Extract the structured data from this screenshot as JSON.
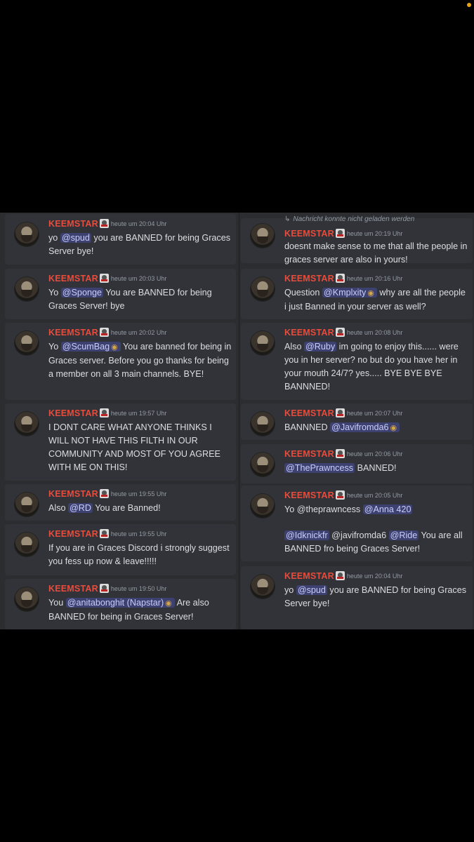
{
  "author": "KEEMSTAR",
  "reply_hint": "Nachricht konnte nicht geladen werden",
  "left": [
    {
      "time": "heute um 20:04 Uhr",
      "parts": [
        {
          "t": "yo "
        },
        {
          "m": "@spud"
        },
        {
          "t": " you are BANNED for being Graces Server bye!"
        }
      ]
    },
    {
      "time": "heute um 20:03 Uhr",
      "parts": [
        {
          "t": "Yo "
        },
        {
          "m": "@Sponge"
        },
        {
          "t": " You are BANNED for being Graces Server! bye"
        }
      ]
    },
    {
      "time": "heute um 20:02 Uhr",
      "parts": [
        {
          "t": "Yo "
        },
        {
          "m": "@ScumBag",
          "badge": true
        },
        {
          "t": " You are banned for being in Graces server. Before you go thanks for being a member on all 3 main channels. BYE!"
        }
      ]
    },
    {
      "time": "heute um 19:57 Uhr",
      "parts": [
        {
          "t": "I DONT CARE WHAT ANYONE THINKS I WILL NOT HAVE THIS FILTH IN OUR COMMUNITY AND MOST OF YOU AGREE WITH ME ON THIS!"
        }
      ]
    },
    {
      "time": "heute um 19:55 Uhr",
      "parts": [
        {
          "t": "Also "
        },
        {
          "m": "@RD"
        },
        {
          "t": " You are Banned!"
        }
      ]
    },
    {
      "time": "heute um 19:55 Uhr",
      "parts": [
        {
          "t": "If you are in Graces Discord i strongly suggest you fess up now & leave!!!!!"
        }
      ]
    },
    {
      "time": "heute um 19:50 Uhr",
      "parts": [
        {
          "t": "You "
        },
        {
          "m": "@anitabonghit (Napstar)",
          "badge": true
        },
        {
          "t": "  Are also BANNED for being in Graces Server!"
        }
      ]
    }
  ],
  "right": [
    {
      "time": "heute um 20:19 Uhr",
      "parts": [
        {
          "t": "doesnt make sense to me that all the people in graces server are also in yours!"
        }
      ]
    },
    {
      "time": "heute um 20:16 Uhr",
      "parts": [
        {
          "t": "Question "
        },
        {
          "m": "@Kmplxity",
          "badge": true
        },
        {
          "t": " why are all the people i just Banned in your server as well?"
        }
      ]
    },
    {
      "time": "heute um 20:08 Uhr",
      "parts": [
        {
          "t": "Also "
        },
        {
          "m": "@Ruby"
        },
        {
          "t": " im going to enjoy this...... were you in her server? no but do you have her in your mouth 24/7? yes..... BYE BYE BYE BANNNED!"
        }
      ]
    },
    {
      "time": "heute um 20:07 Uhr",
      "parts": [
        {
          "t": "BANNNED "
        },
        {
          "m": "@Javifromda6",
          "badge": true
        }
      ]
    },
    {
      "time": "heute um 20:06 Uhr",
      "parts": [
        {
          "m": "@ThePrawncess"
        },
        {
          "t": " BANNED!"
        }
      ]
    },
    {
      "time": "heute um 20:05 Uhr",
      "parts": [
        {
          "t": "Yo @theprawncess  "
        },
        {
          "m": "@Anna 420"
        }
      ],
      "extra": [
        {
          "m": "@Idknickfr"
        },
        {
          "t": "  @javifromda6  "
        },
        {
          "m": "@Ride"
        },
        {
          "t": " You are all BANNED fro being Graces Server!"
        }
      ]
    },
    {
      "time": "heute um 20:04 Uhr",
      "parts": [
        {
          "t": "yo "
        },
        {
          "m": "@spud"
        },
        {
          "t": " you are BANNED for being Graces Server bye!"
        }
      ]
    }
  ]
}
